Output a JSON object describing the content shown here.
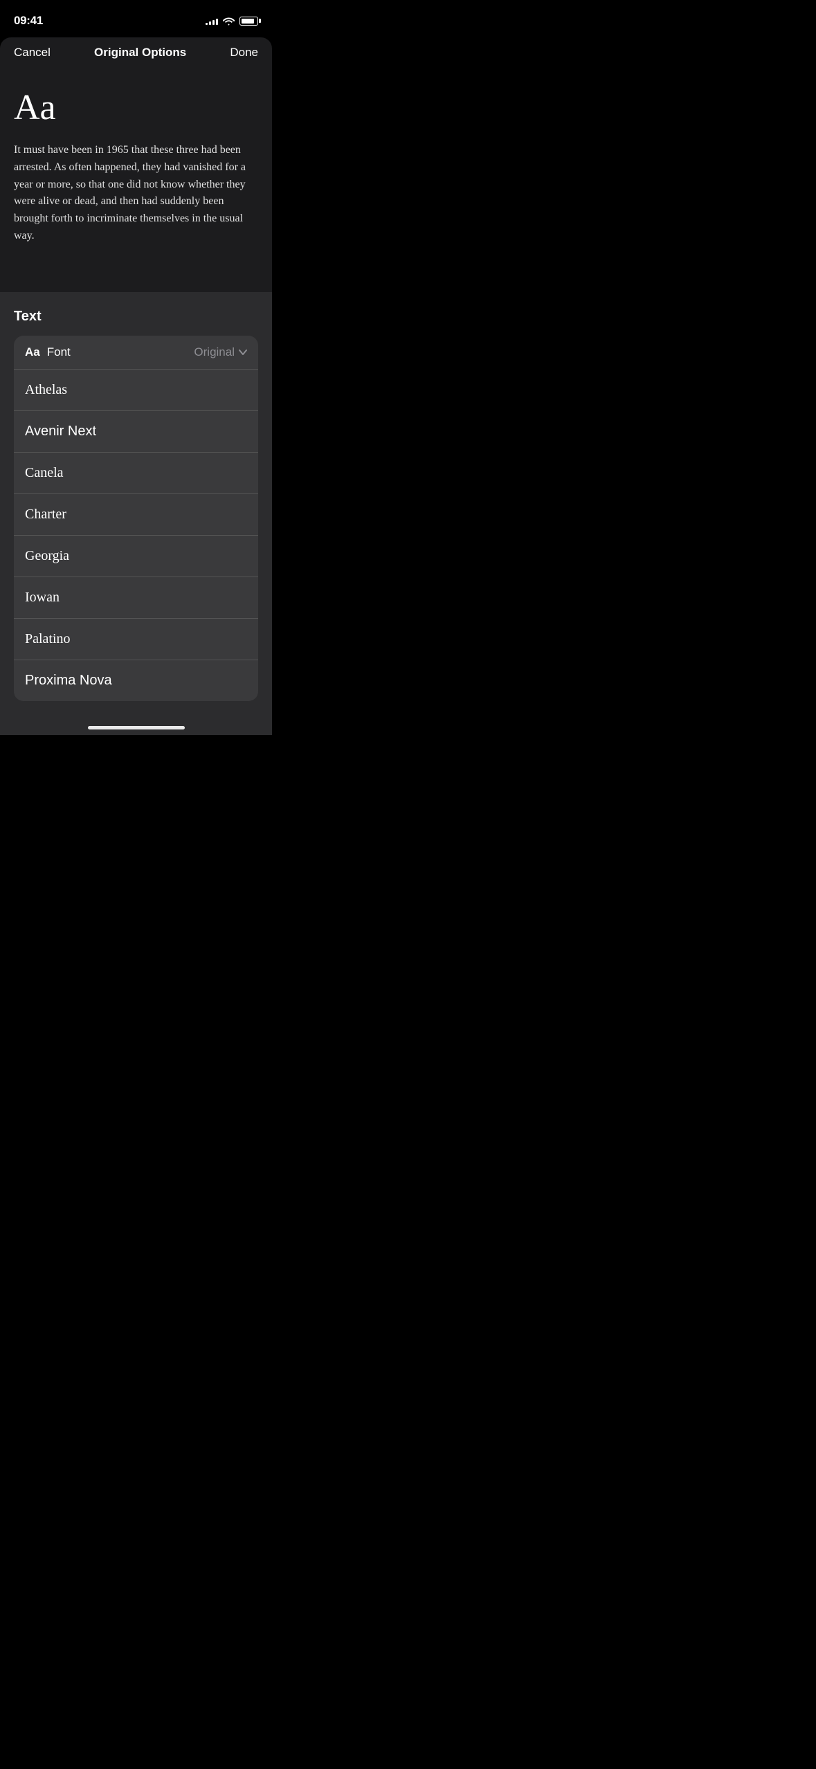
{
  "statusBar": {
    "time": "09:41",
    "signalBars": [
      3,
      5,
      7,
      9,
      11
    ],
    "batteryLevel": 85
  },
  "navBar": {
    "cancelLabel": "Cancel",
    "title": "Original Options",
    "doneLabel": "Done"
  },
  "preview": {
    "aaLabel": "Aa",
    "sampleText": "It must have been in 1965 that these three had been arrested. As often happened, they had vanished for a year or more, so that one did not know whether they were alive or dead, and then had suddenly been brought forth to incriminate themselves in the usual way."
  },
  "textSection": {
    "sectionTitle": "Text",
    "fontHeader": {
      "aaLabel": "Aa",
      "fontLabel": "Font",
      "currentFont": "Original",
      "chevronIcon": "chevron-down"
    },
    "fontList": [
      {
        "name": "Athelas",
        "fontClass": "font-athelas"
      },
      {
        "name": "Avenir Next",
        "fontClass": "font-avenir"
      },
      {
        "name": "Canela",
        "fontClass": "font-canela"
      },
      {
        "name": "Charter",
        "fontClass": "font-charter"
      },
      {
        "name": "Georgia",
        "fontClass": "font-georgia"
      },
      {
        "name": "Iowan",
        "fontClass": "font-iowan"
      },
      {
        "name": "Palatino",
        "fontClass": "font-palatino"
      },
      {
        "name": "Proxima Nova",
        "fontClass": "font-proxima"
      }
    ]
  },
  "colors": {
    "background": "#000000",
    "navBackground": "#1c1c1e",
    "previewBackground": "#1c1c1e",
    "bottomPanelBackground": "#2c2c2e",
    "listBackground": "#3a3a3c",
    "divider": "#555555",
    "textPrimary": "#ffffff",
    "textSecondary": "#8e8e93"
  }
}
